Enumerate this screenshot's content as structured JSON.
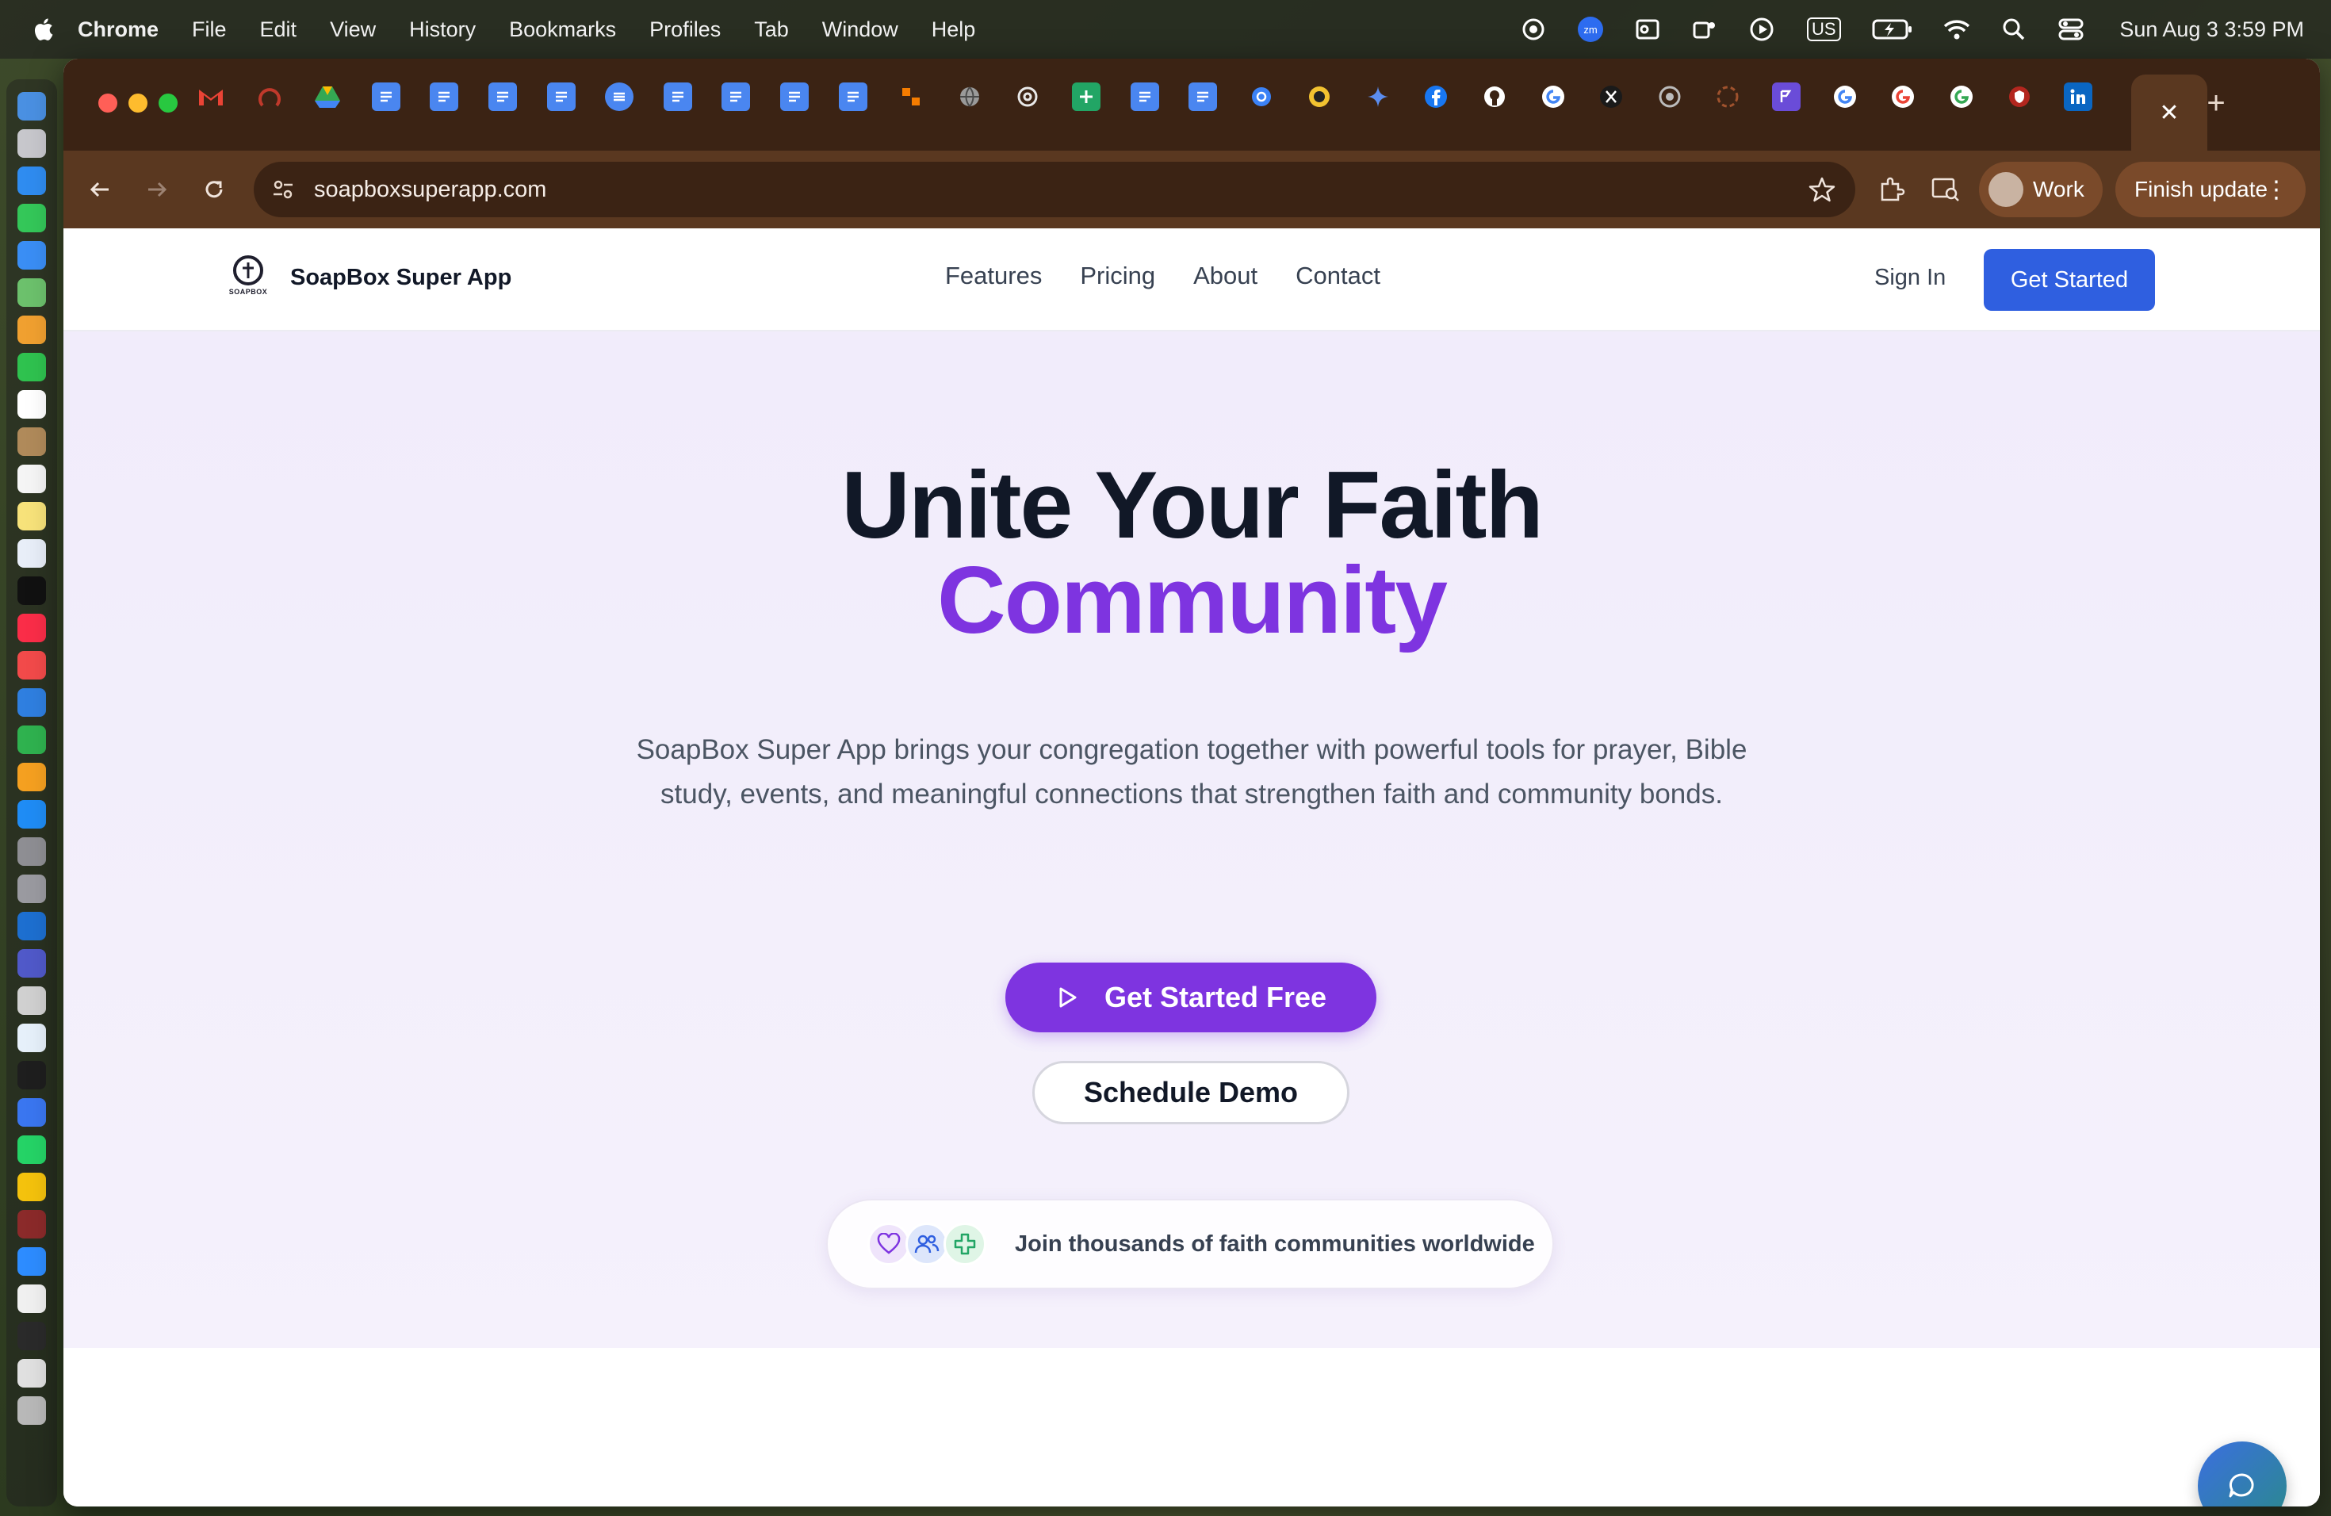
{
  "menubar": {
    "app": "Chrome",
    "items": [
      "File",
      "Edit",
      "View",
      "History",
      "Bookmarks",
      "Profiles",
      "Tab",
      "Window",
      "Help"
    ],
    "keyboard": "US",
    "clock": "Sun Aug 3  3:59 PM"
  },
  "browser": {
    "url": "soapboxsuperapp.com",
    "profile_label": "Work",
    "update_label": "Finish update",
    "tab_close": "✕",
    "new_tab": "+"
  },
  "site": {
    "brand": "SoapBox Super App",
    "logo_text": "SOAPBOX",
    "nav": [
      "Features",
      "Pricing",
      "About",
      "Contact"
    ],
    "sign_in": "Sign In",
    "header_cta": "Get Started"
  },
  "hero": {
    "title_line1": "Unite Your Faith",
    "title_line2": "Community",
    "subtitle": "SoapBox Super App brings your congregation together with powerful tools for prayer, Bible study, events, and meaningful connections that strengthen faith and community bonds.",
    "primary_cta": "Get Started Free",
    "secondary_cta": "Schedule Demo",
    "social_proof": "Join thousands of faith communities worldwide"
  },
  "colors": {
    "accent_purple": "#7e34e0",
    "accent_blue": "#2f5fe0",
    "heading": "#111827"
  }
}
